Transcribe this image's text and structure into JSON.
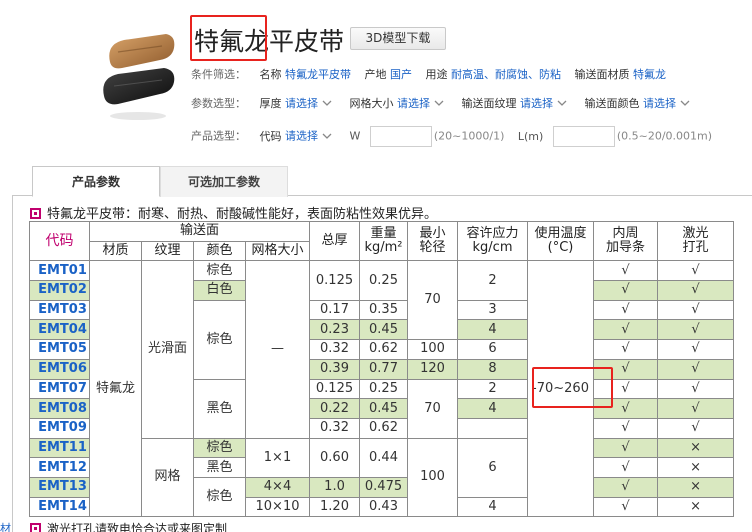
{
  "header": {
    "title": "特氟龙平皮带",
    "download_button": "3D模型下载",
    "filter": {
      "label": "条件筛选：",
      "name_key": "名称",
      "name_val": "特氟龙平皮带",
      "origin_key": "产地",
      "origin_val": "国产",
      "use_key": "用途",
      "use_val": "耐高温、耐腐蚀、防粘",
      "surface_key": "输送面材质",
      "surface_val": "特氟龙"
    },
    "params": {
      "label": "参数选型：",
      "items": [
        {
          "key": "厚度",
          "val": "请选择"
        },
        {
          "key": "网格大小",
          "val": "请选择"
        },
        {
          "key": "输送面纹理",
          "val": "请选择"
        },
        {
          "key": "输送面颜色",
          "val": "请选择"
        }
      ]
    },
    "product": {
      "label": "产品选型：",
      "code_key": "代码",
      "code_val": "请选择",
      "w_label": "W",
      "w_hint": "(20~1000/1)",
      "l_label": "L(m)",
      "l_hint": "(0.5~20/0.001m)"
    }
  },
  "tabs": [
    {
      "label": "产品参数",
      "active": true
    },
    {
      "label": "可选加工参数",
      "active": false
    }
  ],
  "description": "特氟龙平皮带：耐寒、耐热、耐酸碱性能好，表面防粘性效果优异。",
  "table": {
    "h_code": "代码",
    "h_surface": "输送面",
    "h_material": "材质",
    "h_texture": "纹理",
    "h_color": "颜色",
    "h_mesh": "网格大小",
    "h_thickness": "总厚",
    "h_weight_1": "重量",
    "h_weight_2": "kg/m²",
    "h_wheel_1": "最小",
    "h_wheel_2": "轮径",
    "h_stress_1": "容许应力",
    "h_stress_2": "kg/cm",
    "h_temp_1": "使用温度",
    "h_temp_2": "(°C)",
    "h_guide_1": "内周",
    "h_guide_2": "加导条",
    "h_laser_1": "激光",
    "h_laser_2": "打孔",
    "codes": [
      "EMT01",
      "EMT02",
      "EMT03",
      "EMT04",
      "EMT05",
      "EMT06",
      "EMT07",
      "EMT08",
      "EMT09",
      "EMT11",
      "EMT12",
      "EMT13",
      "EMT14"
    ],
    "material": "特氟龙",
    "texture_smooth": "光滑面",
    "texture_mesh": "网格",
    "colors": {
      "brown1": "棕色",
      "white": "白色",
      "brown2": "棕色",
      "black": "黑色",
      "brown3": "棕色",
      "black2": "黑色",
      "brown4": "棕色"
    },
    "mesh_dash": "—",
    "mesh_1x1": "1×1",
    "mesh_4x4": "4×4",
    "mesh_10x10": "10×10",
    "thickness": {
      "r12": "0.125",
      "r3": "0.17",
      "r4": "0.23",
      "r5": "0.32",
      "r6": "0.39",
      "r7": "0.125",
      "r8": "0.22",
      "r9": "0.32",
      "r1112": "0.60",
      "r13": "1.0",
      "r14": "1.20"
    },
    "weight": {
      "r12": "0.25",
      "r3": "0.35",
      "r4": "0.45",
      "r5": "0.62",
      "r6": "0.77",
      "r7": "0.25",
      "r8": "0.45",
      "r9": "0.62",
      "r1112": "0.44",
      "r13": "0.475",
      "r14": "0.43"
    },
    "wheel": {
      "r1to4": "70",
      "r5": "100",
      "r6": "120",
      "r7to9": "70",
      "r11to14": "100"
    },
    "stress": {
      "r12": "2",
      "r3": "3",
      "r4": "4",
      "r5": "6",
      "r6": "8",
      "r7": "2",
      "r8": "4",
      "r11to13": "6",
      "r14": "4"
    },
    "temp": "-70~260",
    "check": "√",
    "cross": "×"
  },
  "footnote": "激光打孔请致电恰合达或来图定制",
  "side_text": "材"
}
